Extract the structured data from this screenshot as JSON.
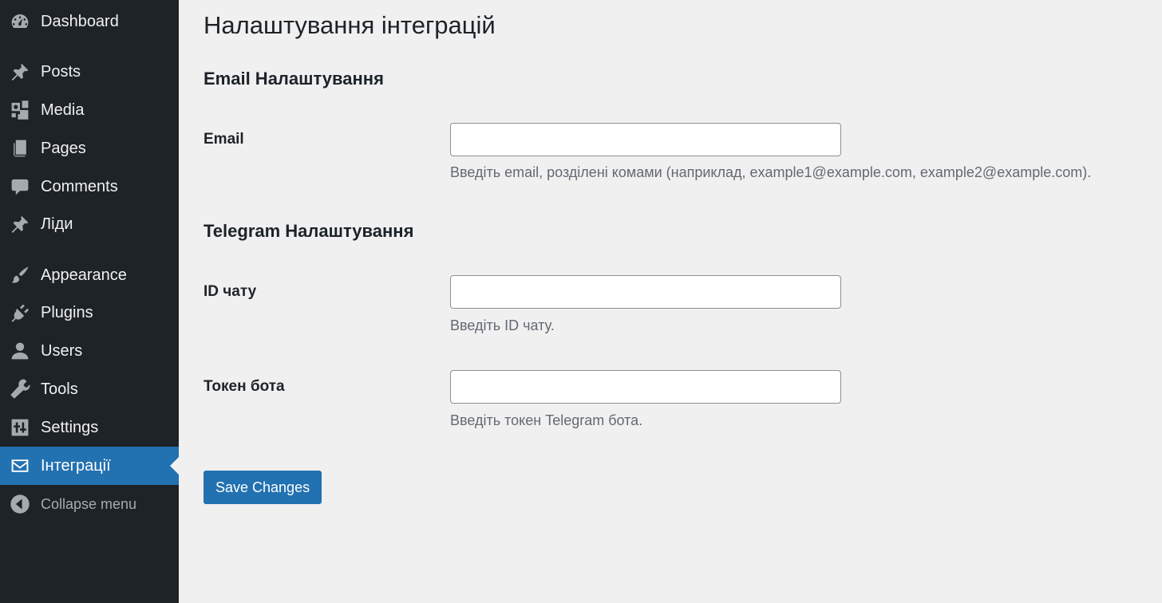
{
  "sidebar": {
    "items": [
      {
        "label": "Dashboard",
        "icon": "dashboard-icon"
      },
      {
        "label": "Posts",
        "icon": "pushpin-icon"
      },
      {
        "label": "Media",
        "icon": "media-icon"
      },
      {
        "label": "Pages",
        "icon": "pages-icon"
      },
      {
        "label": "Comments",
        "icon": "comment-icon"
      },
      {
        "label": "Ліди",
        "icon": "pushpin-icon"
      },
      {
        "label": "Appearance",
        "icon": "paintbrush-icon"
      },
      {
        "label": "Plugins",
        "icon": "plugin-icon"
      },
      {
        "label": "Users",
        "icon": "user-icon"
      },
      {
        "label": "Tools",
        "icon": "wrench-icon"
      },
      {
        "label": "Settings",
        "icon": "sliders-icon"
      },
      {
        "label": "Інтеграції",
        "icon": "envelope-icon",
        "active": true
      },
      {
        "label": "Collapse menu",
        "icon": "collapse-arrow-icon"
      }
    ]
  },
  "page": {
    "title": "Налаштування інтеграцій"
  },
  "email_section": {
    "title": "Email Налаштування",
    "email_label": "Email",
    "email_value": "",
    "email_description": "Введіть email, розділені комами (наприклад, example1@example.com, example2@example.com)."
  },
  "telegram_section": {
    "title": "Telegram Налаштування",
    "chat_id_label": "ID чату",
    "chat_id_value": "",
    "chat_id_description": "Введіть ID чату.",
    "bot_token_label": "Токен бота",
    "bot_token_value": "",
    "bot_token_description": "Введіть токен Telegram бота."
  },
  "actions": {
    "save_label": "Save Changes"
  },
  "colors": {
    "sidebar_bg": "#1d2327",
    "accent": "#2271b1",
    "page_bg": "#f0f0f1",
    "description_text": "#646970"
  }
}
